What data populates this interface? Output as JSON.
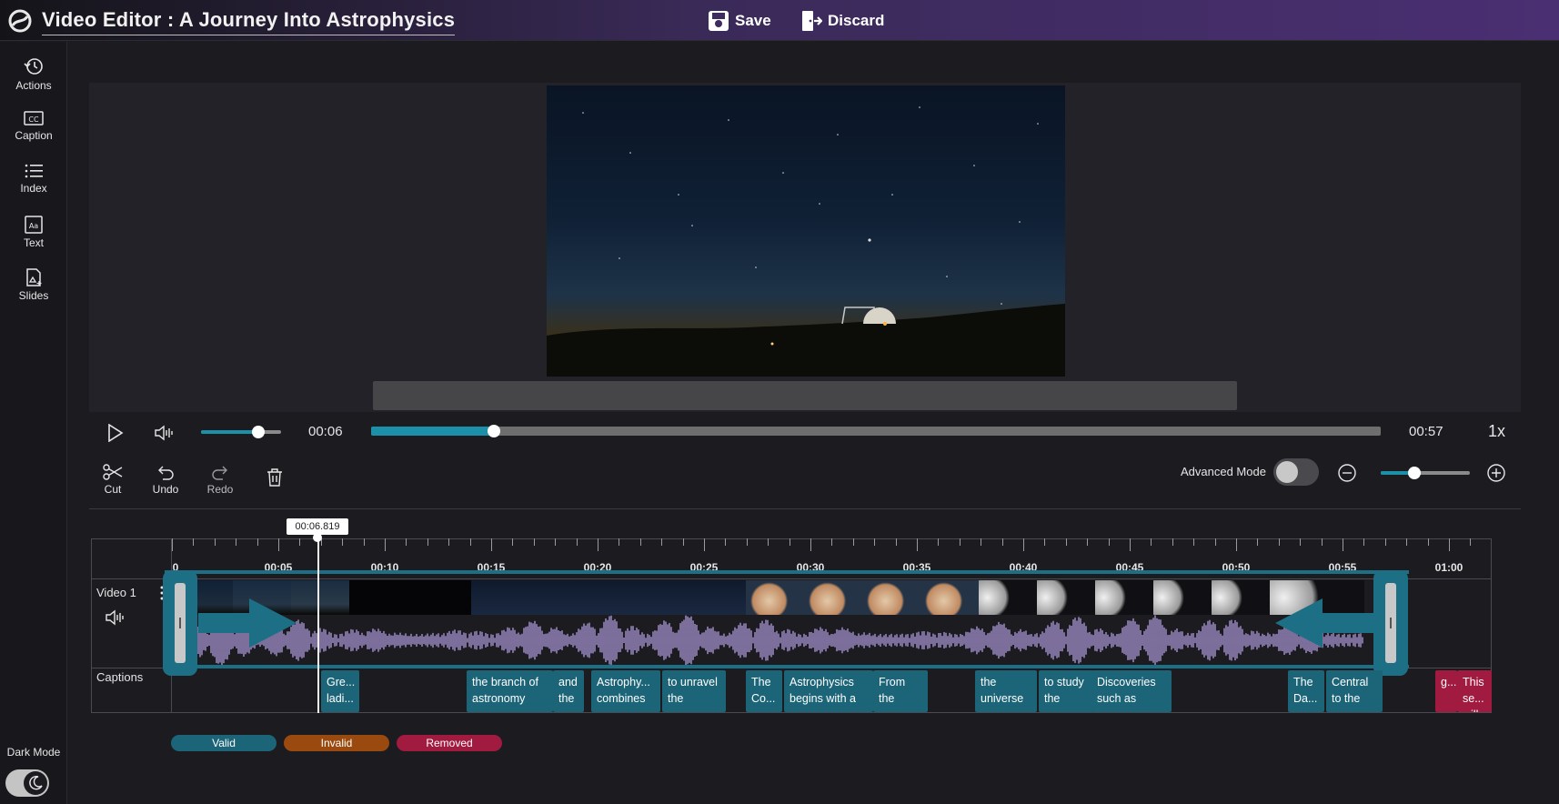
{
  "header": {
    "title": "Video Editor : A Journey Into Astrophysics",
    "save_label": "Save",
    "discard_label": "Discard"
  },
  "sidebar": {
    "items": [
      {
        "label": "Actions",
        "icon": "history-icon"
      },
      {
        "label": "Caption",
        "icon": "closed-caption-icon"
      },
      {
        "label": "Index",
        "icon": "list-icon"
      },
      {
        "label": "Text",
        "icon": "text-box-icon"
      },
      {
        "label": "Slides",
        "icon": "slides-icon"
      }
    ],
    "dark_mode_label": "Dark Mode",
    "dark_mode_on": true
  },
  "player": {
    "current_time": "00:06",
    "duration": "00:57",
    "speed": "1x",
    "volume_fraction": 0.72,
    "progress_fraction": 0.122
  },
  "toolbar": {
    "cut_label": "Cut",
    "undo_label": "Undo",
    "redo_label": "Redo",
    "advanced_mode_label": "Advanced Mode",
    "advanced_mode_on": false,
    "zoom_fraction": 0.38
  },
  "timeline": {
    "playhead_time": "00:06.819",
    "ticks": [
      "0",
      "00:05",
      "00:10",
      "00:15",
      "00:20",
      "00:25",
      "00:30",
      "00:35",
      "00:40",
      "00:45",
      "00:50",
      "00:55",
      "01:00"
    ],
    "video_track_label": "Video 1",
    "captions_track_label": "Captions",
    "captions": [
      {
        "text": "Gre... ladi...",
        "status": "valid"
      },
      {
        "text": "the branch of astronomy",
        "status": "valid"
      },
      {
        "text": "and the",
        "status": "valid"
      },
      {
        "text": "Astrophy... combines",
        "status": "valid"
      },
      {
        "text": "to unravel the",
        "status": "valid"
      },
      {
        "text": "The Co...",
        "status": "valid"
      },
      {
        "text": "Astrophysics begins with a",
        "status": "valid"
      },
      {
        "text": "From the",
        "status": "valid"
      },
      {
        "text": "the universe",
        "status": "valid"
      },
      {
        "text": "to study the",
        "status": "valid"
      },
      {
        "text": "Discoveries such as",
        "status": "valid"
      },
      {
        "text": "The Da...",
        "status": "valid"
      },
      {
        "text": "Central to the",
        "status": "valid"
      },
      {
        "text": "g...",
        "status": "removed"
      },
      {
        "text": "This se... will de...",
        "status": "removed"
      }
    ]
  },
  "legend": {
    "valid_label": "Valid",
    "invalid_label": "Invalid",
    "removed_label": "Removed",
    "valid_color": "#1c6478",
    "invalid_color": "#9a4a0e",
    "removed_color": "#a11a40"
  },
  "colors": {
    "accent": "#1b90a8",
    "trim": "#1d6f86",
    "waveform": "#a693d0"
  }
}
